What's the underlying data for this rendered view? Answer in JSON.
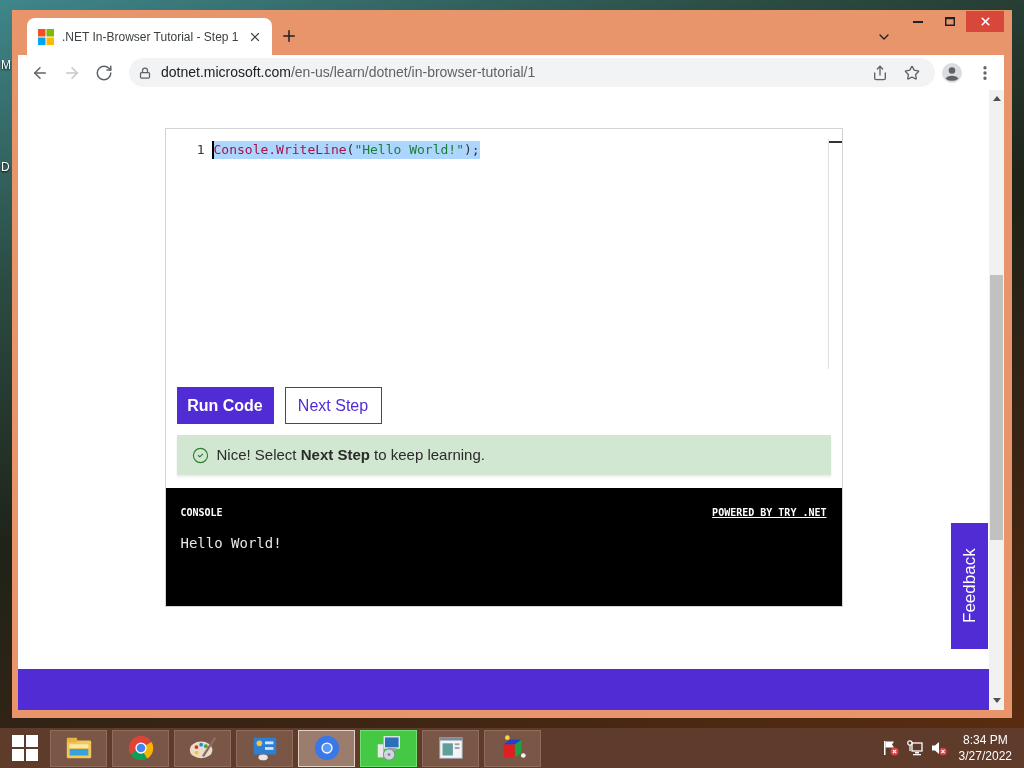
{
  "desktop": {
    "icon_labels": [
      "M",
      "D"
    ]
  },
  "browser": {
    "tabs": [
      {
        "title": ".NET In-Browser Tutorial - Step 1",
        "selected": true
      }
    ],
    "nav": [
      {
        "kind": "back",
        "disabled": false
      },
      {
        "kind": "forward",
        "disabled": true
      },
      {
        "kind": "reload",
        "disabled": false
      }
    ],
    "address": {
      "host": "dotnet.microsoft.com",
      "path": "/en-us/learn/dotnet/in-browser-tutorial/1"
    }
  },
  "editor": {
    "lines": [
      {
        "number": "1",
        "selected": true,
        "tokens": [
          {
            "text": "Console.WriteLine",
            "kind": "method"
          },
          {
            "text": "(",
            "kind": "punct"
          },
          {
            "text": "\"Hello World!\"",
            "kind": "string"
          },
          {
            "text": ");",
            "kind": "punct"
          }
        ]
      }
    ]
  },
  "buttons": [
    {
      "label": "Run Code",
      "kind": "primary"
    },
    {
      "label": "Next Step",
      "kind": "outline"
    }
  ],
  "alert": {
    "kind": "success",
    "text": "Nice! Select **Next Step** to keep learning."
  },
  "console": {
    "title": "CONSOLE",
    "link": "POWERED BY TRY .NET",
    "output": [
      "Hello World!"
    ]
  },
  "feedback": {
    "label": "Feedback"
  },
  "taskbar": {
    "apps": [
      {
        "selected": false,
        "flashing": false
      },
      {
        "selected": false,
        "flashing": false
      },
      {
        "selected": false,
        "flashing": false
      },
      {
        "selected": false,
        "flashing": false
      },
      {
        "selected": true,
        "flashing": false
      },
      {
        "selected": false,
        "flashing": true
      },
      {
        "selected": false,
        "flashing": false
      },
      {
        "selected": false,
        "flashing": false
      }
    ],
    "clock": {
      "time": "8:34 PM",
      "date": "3/27/2022"
    }
  }
}
